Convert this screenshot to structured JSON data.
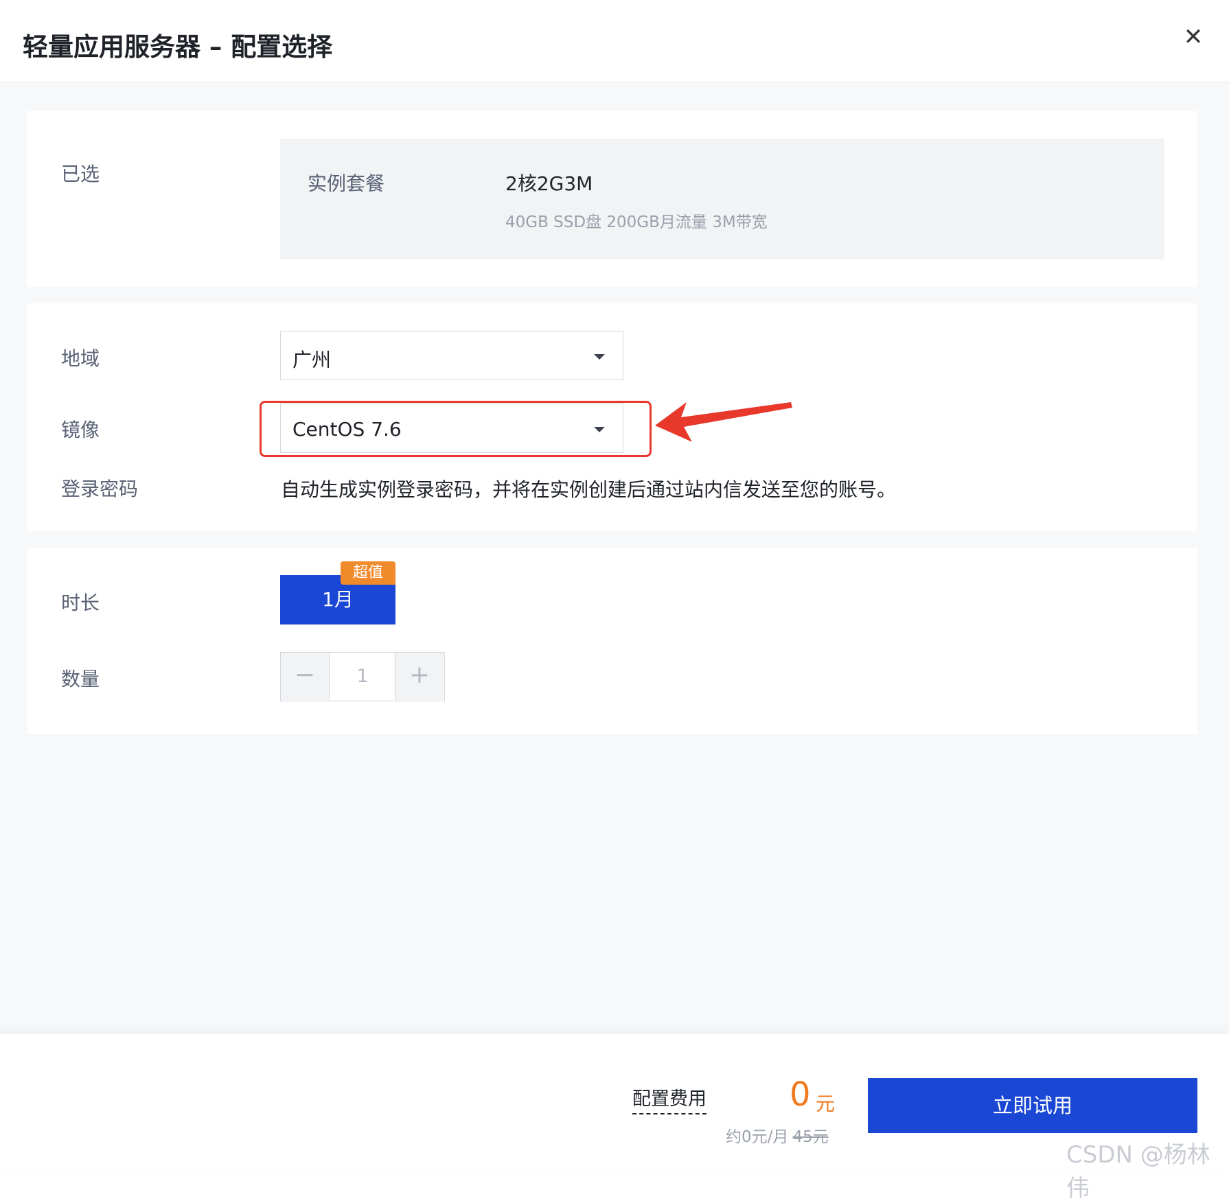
{
  "header": {
    "title": "轻量应用服务器 – 配置选择",
    "close_icon": "close-icon"
  },
  "selected": {
    "label": "已选",
    "package_label": "实例套餐",
    "package_name": "2核2G3M",
    "package_desc": "40GB SSD盘 200GB月流量 3M带宽"
  },
  "region": {
    "label": "地域",
    "value": "广州"
  },
  "image": {
    "label": "镜像",
    "value": "CentOS 7.6"
  },
  "password": {
    "label": "登录密码",
    "text": "自动生成实例登录密码，并将在实例创建后通过站内信发送至您的账号。"
  },
  "duration": {
    "label": "时长",
    "option": "1月",
    "badge": "超值"
  },
  "quantity": {
    "label": "数量",
    "value": "1",
    "minus": "−",
    "plus": "+"
  },
  "footer": {
    "fee_label": "配置费用",
    "price": "0",
    "price_unit": "元",
    "monthly": "约0元/月",
    "original": "45元",
    "cta": "立即试用",
    "watermark": "CSDN @杨林伟"
  },
  "colors": {
    "primary": "#1a47d4",
    "price": "#f07a1e",
    "badge": "#f08a2a",
    "annotation": "#e8382c"
  }
}
